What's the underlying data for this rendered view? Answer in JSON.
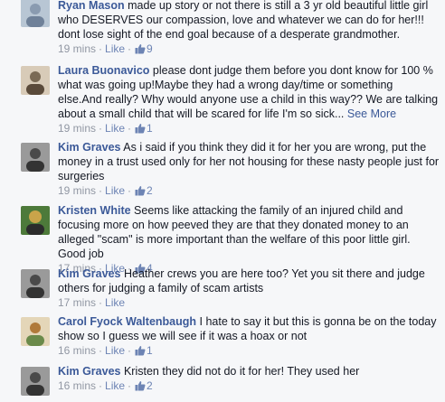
{
  "comments": [
    {
      "author": "Ryan Mason",
      "text": "made up story or not there is still a 3 yr old beautiful little girl who DESERVES our compassion, love and whatever we can do for her!!! dont lose sight of the end goal because of a desperate grandmother.",
      "see_more": "",
      "time": "19 mins",
      "like_label": "Like",
      "likes": "9",
      "avatar_color": "#8a9bb0"
    },
    {
      "author": "Laura Buonavico",
      "text": "please dont judge them before you dont know for 100 % what was going up!Maybe they had a wrong day/time or something else.And really? Why would anyone use a child in this way?? We are talking about a small child that will be scared for life I'm so sick...",
      "see_more": "See More",
      "time": "19 mins",
      "like_label": "Like",
      "likes": "1",
      "avatar_color": "#7a6a55"
    },
    {
      "author": "Kim Graves",
      "text": "As i said if you think they did it for her you are wrong, put the money in a trust used only for her not housing for these nasty people just for surgeries",
      "see_more": "",
      "time": "19 mins",
      "like_label": "Like",
      "likes": "2",
      "avatar_color": "#4a4a4a"
    },
    {
      "author": "Kristen White",
      "text": "Seems like attacking the family of an injured child and focusing more on how peeved they are that they donated money to an alleged \"scam\" is more important than the welfare of this poor little girl. Good job",
      "see_more": "",
      "time": "17 mins",
      "like_label": "Like",
      "likes": "4",
      "avatar_color": "#c9a44a"
    },
    {
      "author": "Kim Graves",
      "text": "Heather crews you are here too? Yet you sit there and judge others for judging a family of scam artists",
      "see_more": "",
      "time": "17 mins",
      "like_label": "Like",
      "likes": "",
      "avatar_color": "#4a4a4a"
    },
    {
      "author": "Carol Fyock Waltenbaugh",
      "text": "I hate to say it but this is gonna be on the today show so I guess we will see if it was a hoax or not",
      "see_more": "",
      "time": "16 mins",
      "like_label": "Like",
      "likes": "1",
      "avatar_color": "#b07a3a"
    },
    {
      "author": "Kim Graves",
      "text": "Kristen they did not do it for her! They used her",
      "see_more": "",
      "time": "16 mins",
      "like_label": "Like",
      "likes": "2",
      "avatar_color": "#4a4a4a"
    }
  ],
  "meta_separator": "·"
}
